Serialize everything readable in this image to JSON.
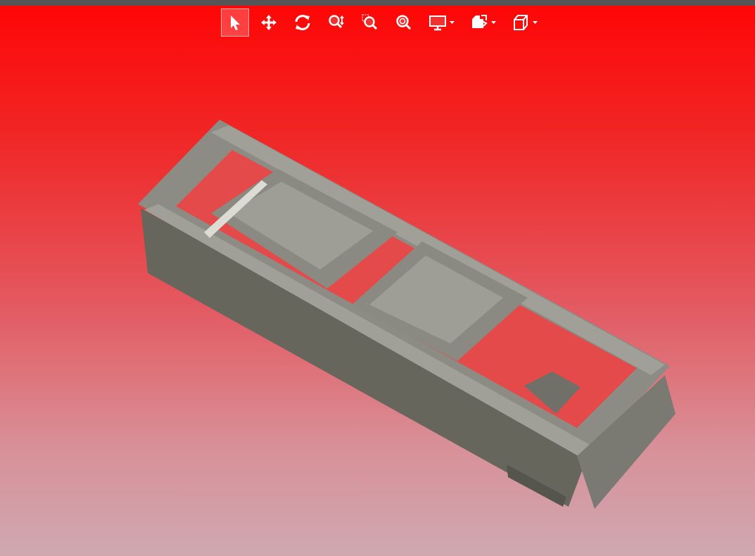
{
  "toolbar": {
    "tools": [
      {
        "kind": "select",
        "selected": true,
        "dropdown": false
      },
      {
        "kind": "pan",
        "selected": false,
        "dropdown": false
      },
      {
        "kind": "rotate",
        "selected": false,
        "dropdown": false
      },
      {
        "kind": "zoom",
        "selected": false,
        "dropdown": false
      },
      {
        "kind": "zoomwindow",
        "selected": false,
        "dropdown": false
      },
      {
        "kind": "zoomfit",
        "selected": false,
        "dropdown": false
      },
      {
        "kind": "display",
        "selected": false,
        "dropdown": true
      },
      {
        "kind": "views",
        "selected": false,
        "dropdown": true
      },
      {
        "kind": "cube",
        "selected": false,
        "dropdown": true
      }
    ]
  }
}
